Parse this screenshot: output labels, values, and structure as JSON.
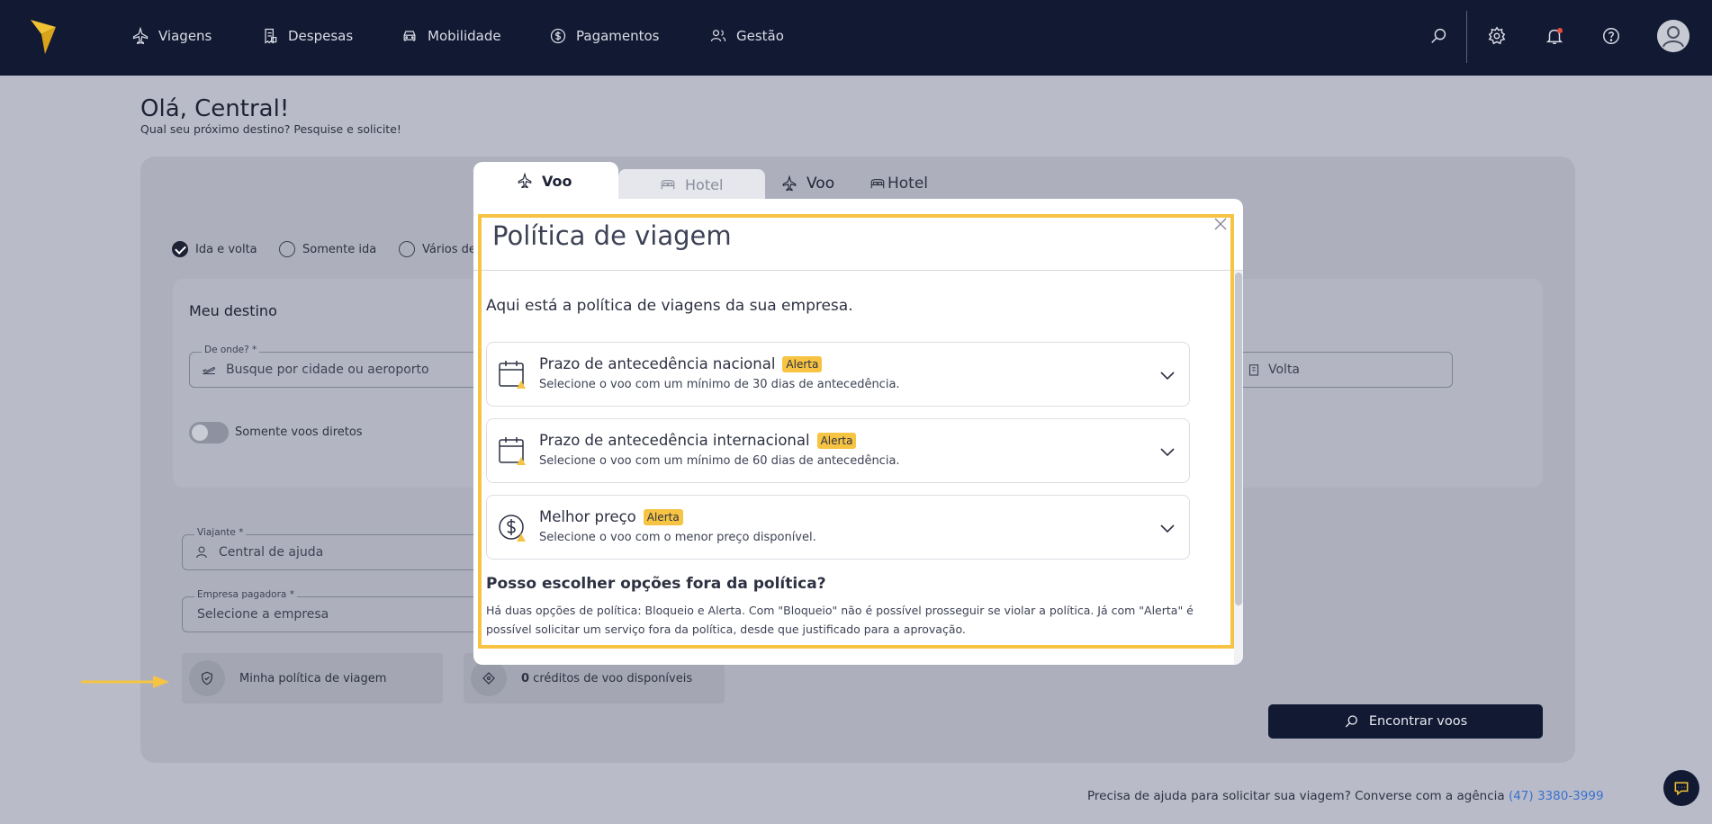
{
  "nav": {
    "items": [
      {
        "label": "Viagens",
        "icon": "plane-icon"
      },
      {
        "label": "Despesas",
        "icon": "receipt-icon"
      },
      {
        "label": "Mobilidade",
        "icon": "car-icon"
      },
      {
        "label": "Pagamentos",
        "icon": "dollar-circle-icon"
      },
      {
        "label": "Gestão",
        "icon": "users-icon"
      }
    ]
  },
  "greeting": {
    "title": "Olá, Central!",
    "subtitle": "Qual seu próximo destino? Pesquise e solicite!"
  },
  "tabs": {
    "active": "Voo",
    "inactive": "Hotel",
    "plain_voo": "Voo",
    "plain_hotel": "Hotel"
  },
  "trip_type": {
    "options": [
      "Ida e volta",
      "Somente ida",
      "Vários de"
    ],
    "selected": "Ida e volta"
  },
  "destination": {
    "title": "Meu destino",
    "from_label": "De onde? *",
    "from_placeholder": "Busque por cidade ou aeroporto",
    "return_placeholder": "Volta",
    "direct_only_label": "Somente voos diretos"
  },
  "traveler": {
    "label": "Viajante *",
    "value": "Central de ajuda"
  },
  "company": {
    "label": "Empresa pagadora *",
    "placeholder": "Selecione a empresa"
  },
  "policy_button": {
    "label": "Minha política de viagem"
  },
  "credits": {
    "count": "0",
    "label": " créditos de voo disponíveis"
  },
  "find_button": {
    "label": "Encontrar voos"
  },
  "footer": {
    "help_text": "Precisa de ajuda para solicitar sua viagem? Converse com a agência ",
    "phone": "(47) 3380-3999"
  },
  "modal": {
    "title": "Política de viagem",
    "intro": "Aqui está a política de viagens da sua empresa.",
    "policies": [
      {
        "title": "Prazo de antecedência nacional",
        "badge": "Alerta",
        "description": "Selecione o voo com um mínimo de 30 dias de antecedência.",
        "icon": "calendar-alert-icon"
      },
      {
        "title": "Prazo de antecedência internacional",
        "badge": "Alerta",
        "description": "Selecione o voo com um mínimo de 60 dias de antecedência.",
        "icon": "calendar-alert-icon"
      },
      {
        "title": "Melhor preço",
        "badge": "Alerta",
        "description": "Selecione o voo com o menor preço disponível.",
        "icon": "dollar-alert-icon"
      }
    ],
    "faq_question": "Posso escolher opções fora da política?",
    "faq_answer": "Há duas opções de política: Bloqueio e Alerta. Com \"Bloqueio\" não é possível prosseguir se violar a política. Já com \"Alerta\" é possível solicitar um serviço fora da política, desde que justificado para a aprovação."
  },
  "colors": {
    "navbar": "#121a33",
    "highlight": "#f6c343",
    "badge": "#f6c343",
    "link": "#3b6fd1"
  }
}
